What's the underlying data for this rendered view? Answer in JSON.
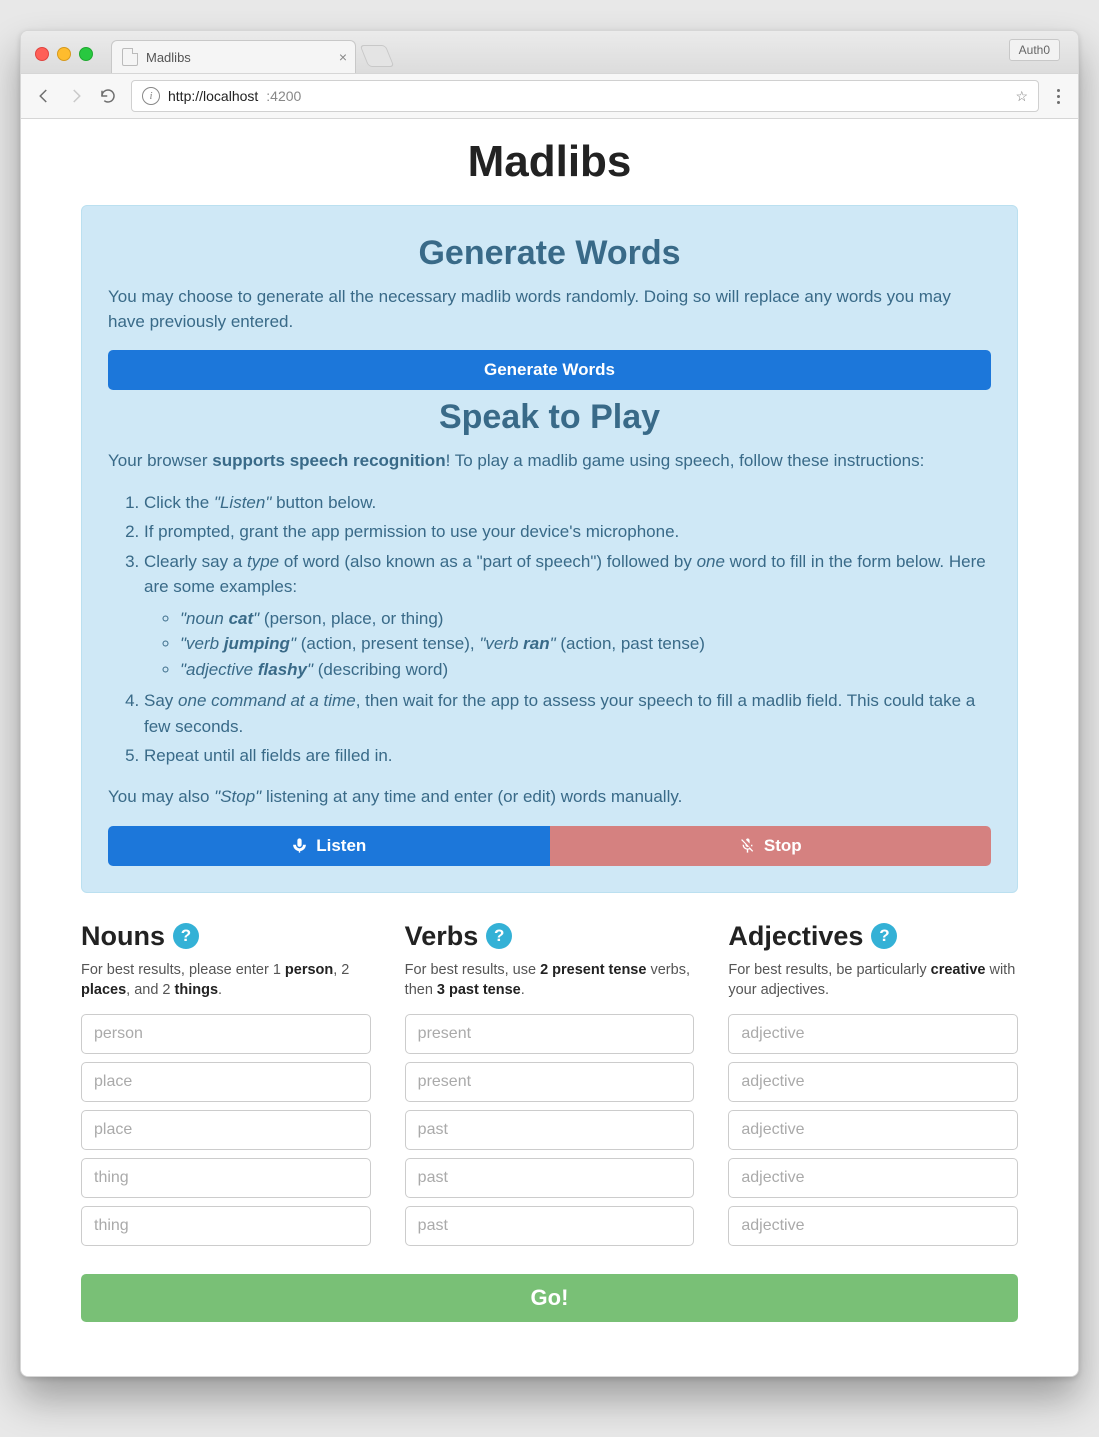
{
  "browser": {
    "tab_title": "Madlibs",
    "url_host": "http://localhost",
    "url_rest": ":4200",
    "extension_label": "Auth0"
  },
  "page_title": "Madlibs",
  "panel": {
    "gen_heading": "Generate Words",
    "gen_desc": "You may choose to generate all the necessary madlib words randomly. Doing so will replace any words you may have previously entered.",
    "gen_button": "Generate Words",
    "speak_heading": "Speak to Play",
    "speak_intro_pre": "Your browser ",
    "speak_intro_bold": "supports speech recognition",
    "speak_intro_post": "! To play a madlib game using speech, follow these instructions:",
    "steps": {
      "s1_pre": "Click the ",
      "s1_em": "\"Listen\"",
      "s1_post": " button below.",
      "s2": "If prompted, grant the app permission to use your device's microphone.",
      "s3_pre": "Clearly say a ",
      "s3_em1": "type",
      "s3_mid": " of word (also known as a \"part of speech\") followed by ",
      "s3_em2": "one",
      "s3_post": " word to fill in the form below. Here are some examples:",
      "ex1_em_pre": "\"noun ",
      "ex1_em_bold": "cat",
      "ex1_em_post": "\"",
      "ex1_tail": " (person, place, or thing)",
      "ex2_em1_pre": "\"verb ",
      "ex2_em1_bold": "jumping",
      "ex2_em1_post": "\"",
      "ex2_mid": " (action, present tense), ",
      "ex2_em2_pre": "\"verb ",
      "ex2_em2_bold": "ran",
      "ex2_em2_post": "\"",
      "ex2_tail": " (action, past tense)",
      "ex3_em_pre": "\"adjective ",
      "ex3_em_bold": "flashy",
      "ex3_em_post": "\"",
      "ex3_tail": " (describing word)",
      "s4_pre": "Say ",
      "s4_em": "one command at a time",
      "s4_post": ", then wait for the app to assess your speech to fill a madlib field. This could take a few seconds.",
      "s5": "Repeat until all fields are filled in."
    },
    "stop_line_pre": "You may also ",
    "stop_line_em": "\"Stop\"",
    "stop_line_post": " listening at any time and enter (or edit) words manually.",
    "listen_label": "Listen",
    "stop_label": "Stop"
  },
  "columns": {
    "nouns": {
      "heading": "Nouns",
      "hint_pre": "For best results, please enter 1 ",
      "hint_b1": "person",
      "hint_mid1": ", 2 ",
      "hint_b2": "places",
      "hint_mid2": ", and 2 ",
      "hint_b3": "things",
      "hint_post": ".",
      "placeholders": [
        "person",
        "place",
        "place",
        "thing",
        "thing"
      ]
    },
    "verbs": {
      "heading": "Verbs",
      "hint_pre": "For best results, use ",
      "hint_b1": "2 present tense",
      "hint_mid1": " verbs, then ",
      "hint_b2": "3 past tense",
      "hint_post": ".",
      "placeholders": [
        "present",
        "present",
        "past",
        "past",
        "past"
      ]
    },
    "adjectives": {
      "heading": "Adjectives",
      "hint_pre": "For best results, be particularly ",
      "hint_b1": "creative",
      "hint_post": " with your adjectives.",
      "placeholders": [
        "adjective",
        "adjective",
        "adjective",
        "adjective",
        "adjective"
      ]
    }
  },
  "go_label": "Go!",
  "help_glyph": "?"
}
